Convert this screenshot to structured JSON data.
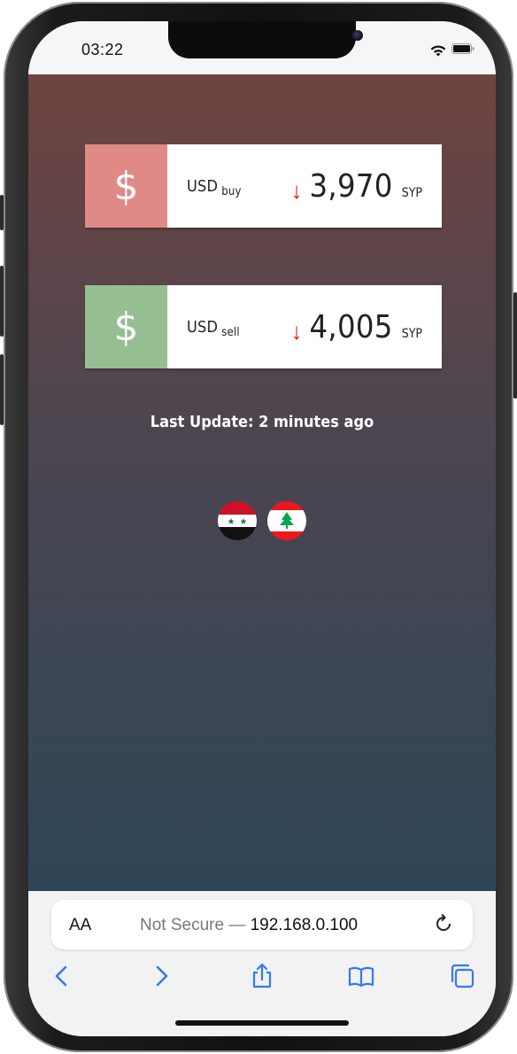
{
  "status_bar": {
    "time": "03:22"
  },
  "cards": [
    {
      "icon": "dollar-icon",
      "icon_glyph": "$",
      "icon_bg": "#e08a87",
      "currency": "USD",
      "type": "buy",
      "trend": "down",
      "trend_glyph": "↓",
      "value": "3,970",
      "unit": "SYP"
    },
    {
      "icon": "dollar-icon",
      "icon_glyph": "$",
      "icon_bg": "#97bd92",
      "currency": "USD",
      "type": "sell",
      "trend": "down",
      "trend_glyph": "↓",
      "value": "4,005",
      "unit": "SYP"
    }
  ],
  "last_update": "Last Update: 2 minutes ago",
  "flags": [
    "syria-flag-icon",
    "lebanon-flag-icon"
  ],
  "safari": {
    "text_size_label": "AA",
    "security_text": "Not Secure —",
    "host": "192.168.0.100"
  },
  "colors": {
    "trend_down": "#e02010",
    "accent": "#3478f6"
  }
}
